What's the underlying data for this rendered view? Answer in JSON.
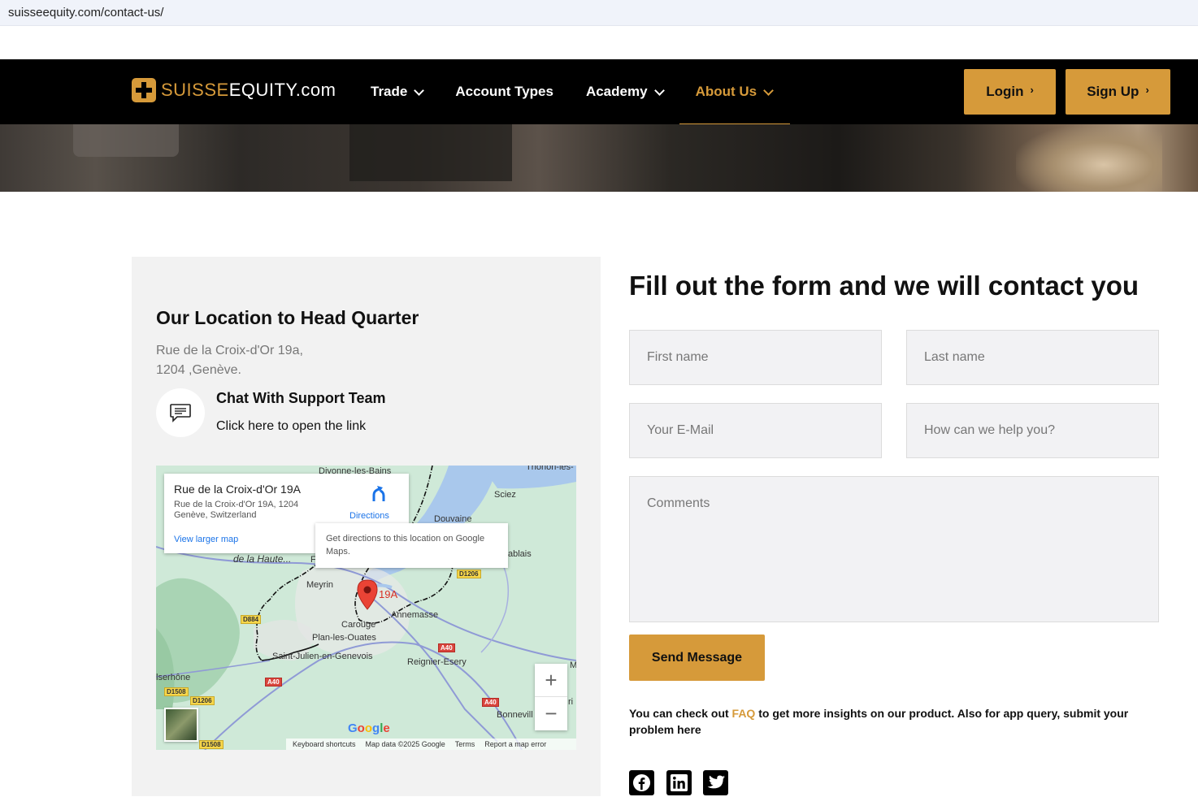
{
  "browser": {
    "url": "suisseequity.com/contact-us/"
  },
  "header": {
    "logo": {
      "part1": "SUISSE",
      "part2": "EQUITY",
      "part3": ".com"
    },
    "nav": [
      {
        "label": "Trade",
        "has_dropdown": true,
        "active": false
      },
      {
        "label": "Account Types",
        "has_dropdown": false,
        "active": false
      },
      {
        "label": "Academy",
        "has_dropdown": true,
        "active": false
      },
      {
        "label": "About Us",
        "has_dropdown": true,
        "active": true
      }
    ],
    "login_label": "Login",
    "signup_label": "Sign Up",
    "arrow_glyph": "›"
  },
  "location": {
    "title": "Our Location to Head Quarter",
    "address_line1": "Rue de la Croix-d'Or 19a,",
    "address_line2": "1204 ,Genève.",
    "chat_title": "Chat With Support Team",
    "chat_link": "Click here to open the link",
    "icon": "chat-bubble-icon"
  },
  "map": {
    "card_title": "Rue de la Croix-d'Or 19A",
    "card_address": "Rue de la Croix-d'Or 19A, 1204 Genève, Switzerland",
    "view_larger": "View larger map",
    "directions": "Directions",
    "tooltip": "Get directions to this location on Google Maps.",
    "pin_label": "19A",
    "places": [
      "Divonne-les-Bains",
      "Thonon-les-",
      "Sciez",
      "Douvaine",
      "de la Haute...",
      "ablais",
      "Meyrin",
      "Annemasse",
      "Carouge",
      "Plan-les-Ouates",
      "Saint-Julien-en-Genevois",
      "Reignier-Esery",
      "lserhône",
      "Bonnevill",
      "M",
      "ri",
      "F"
    ],
    "roads": [
      "D1206",
      "D884",
      "A40",
      "A40",
      "A40",
      "D1508",
      "D1206",
      "D1508"
    ],
    "zoom_in": "+",
    "zoom_out": "−",
    "google": "Google",
    "footer": [
      "Keyboard shortcuts",
      "Map data ©2025 Google",
      "Terms",
      "Report a map error"
    ]
  },
  "form": {
    "title": "Fill out the form and we will contact you",
    "first_name": "First name",
    "last_name": "Last name",
    "email": "Your E-Mail",
    "help": "How can we help you?",
    "comments": "Comments",
    "submit": "Send Message",
    "note_before": "You can check out ",
    "note_link": "FAQ",
    "note_after": " to get more insights on our product. Also for app query, submit your problem here"
  },
  "social": [
    "facebook-icon",
    "linkedin-icon",
    "twitter-icon"
  ],
  "colors": {
    "accent": "#d69a3a",
    "header_bg": "#000000",
    "panel_bg": "#f2f2f2",
    "field_bg": "#f2f2f4"
  }
}
